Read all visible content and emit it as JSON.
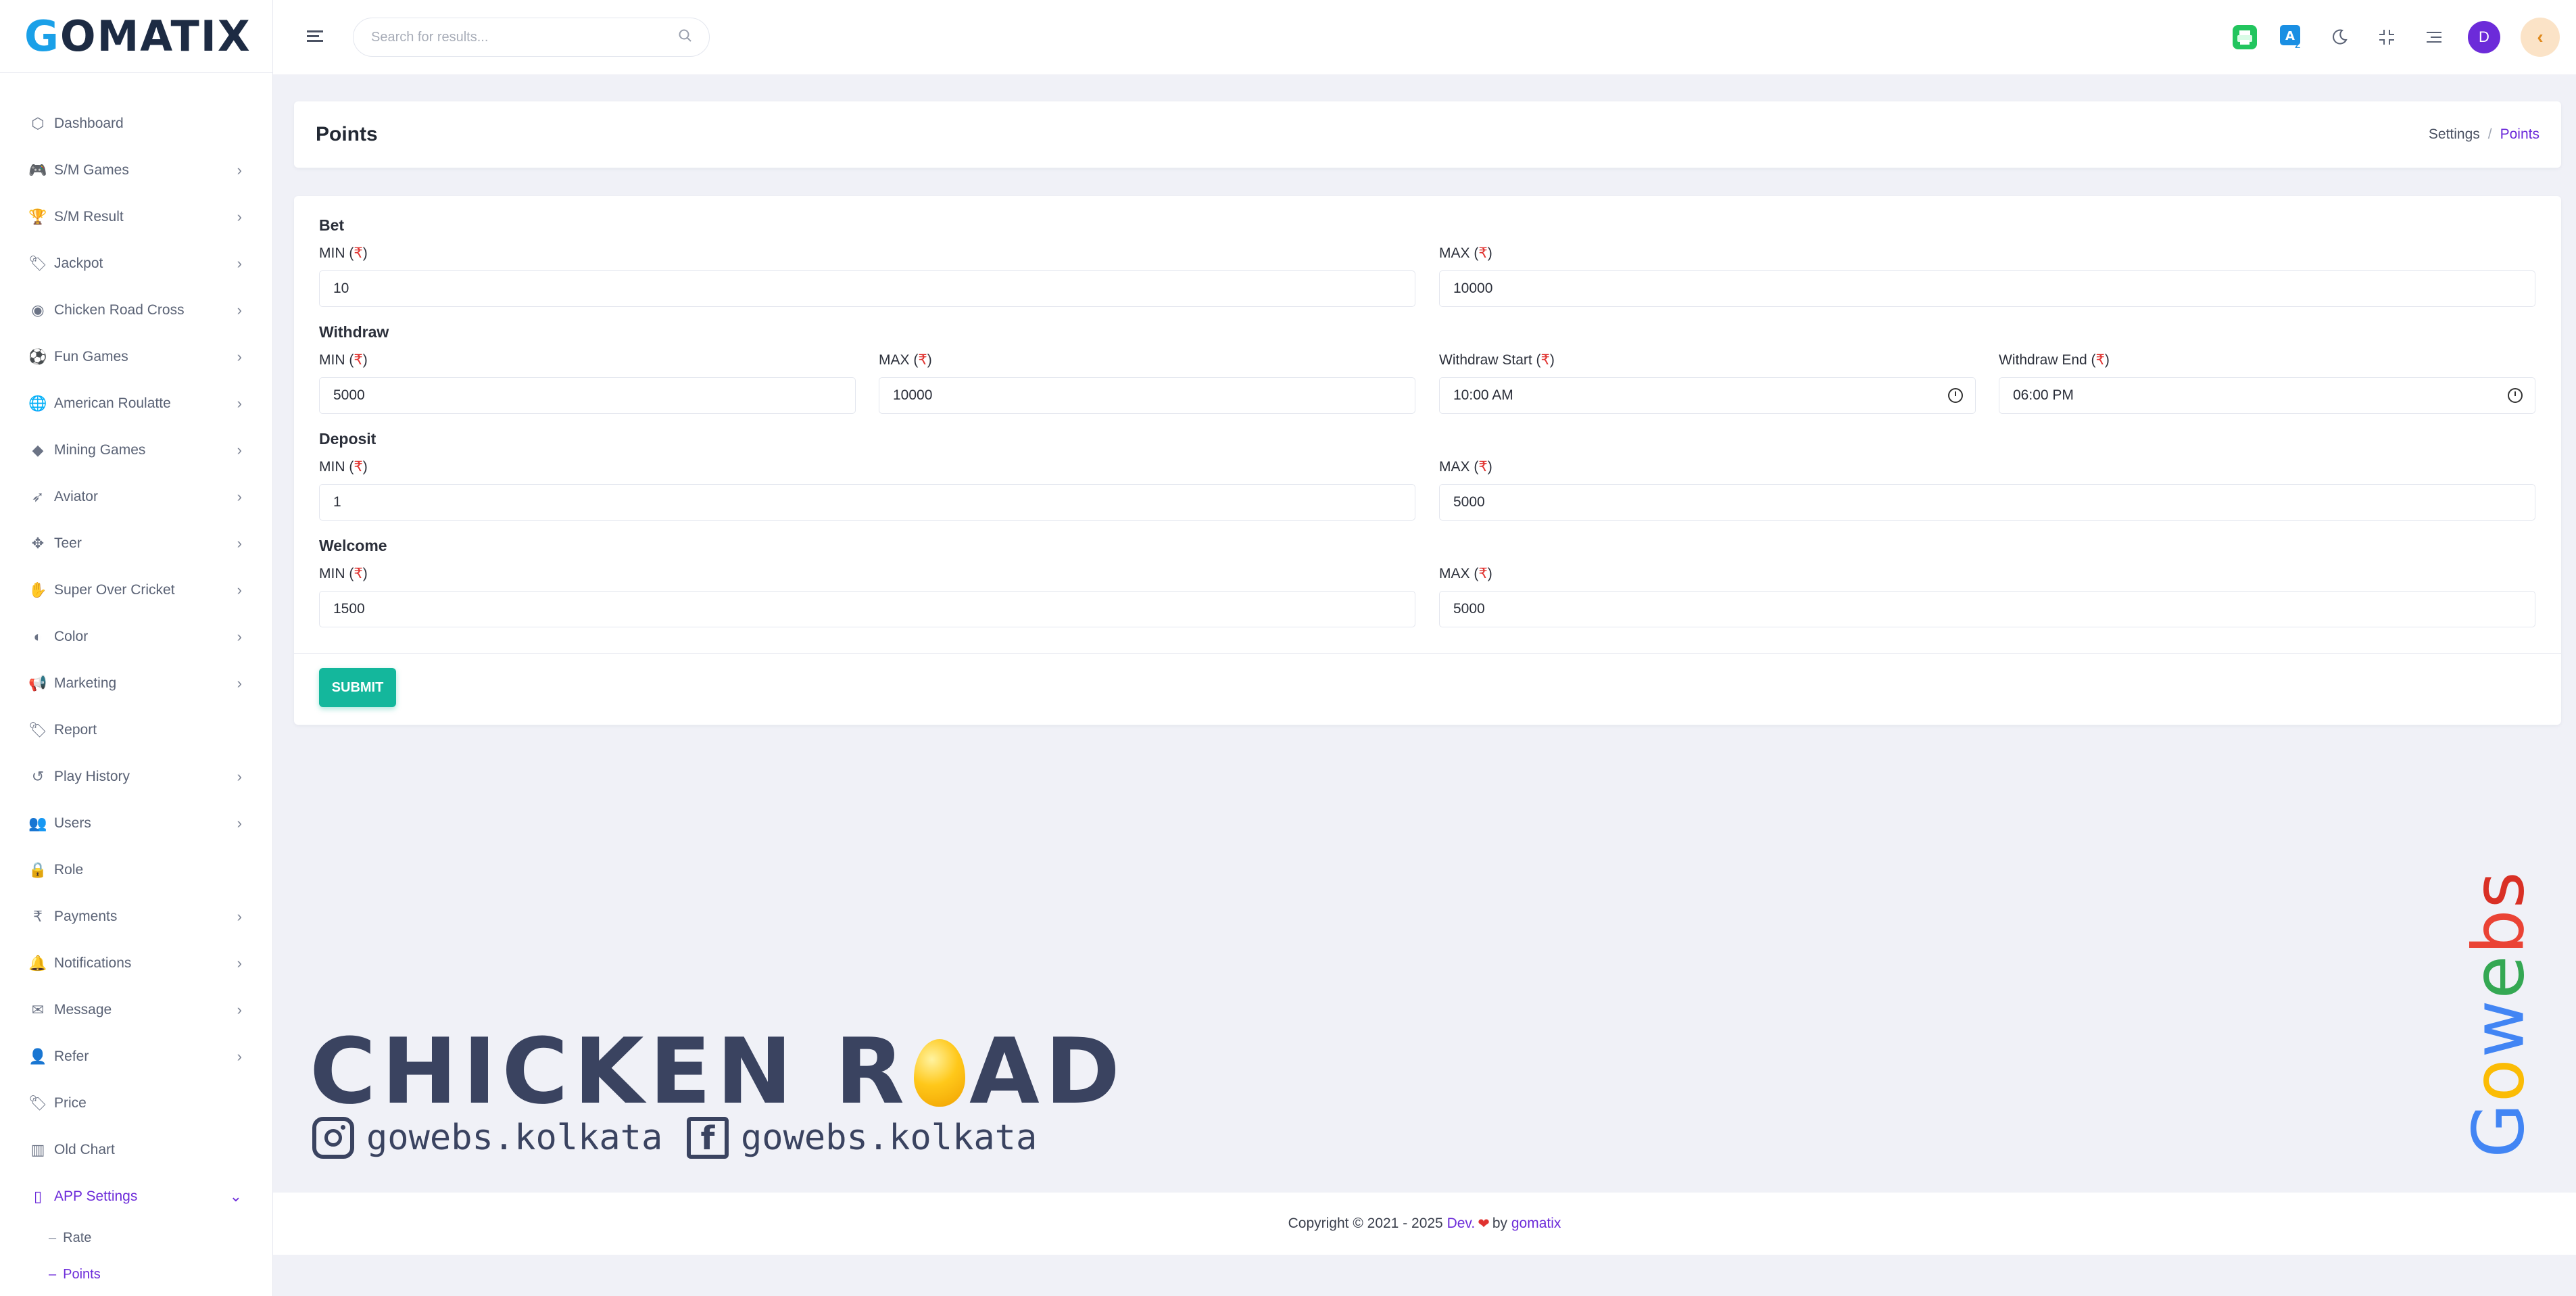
{
  "brand": {
    "logo_text": "GOMATIX",
    "accent": "#6c2bd9",
    "logo_color": "#1d2b43"
  },
  "sidebar": {
    "items": [
      {
        "label": "Dashboard",
        "icon": "cube-icon",
        "has_children": false
      },
      {
        "label": "S/M Games",
        "icon": "gamepad-icon",
        "has_children": true
      },
      {
        "label": "S/M Result",
        "icon": "trophy-icon",
        "has_children": true
      },
      {
        "label": "Jackpot",
        "icon": "tag-icon",
        "has_children": true
      },
      {
        "label": "Chicken Road Cross",
        "icon": "steering-icon",
        "has_children": true
      },
      {
        "label": "Fun Games",
        "icon": "soccer-icon",
        "has_children": true
      },
      {
        "label": "American Roulatte",
        "icon": "globe-icon",
        "has_children": true
      },
      {
        "label": "Mining Games",
        "icon": "diamond-icon",
        "has_children": true
      },
      {
        "label": "Aviator",
        "icon": "rocket-icon",
        "has_children": true
      },
      {
        "label": "Teer",
        "icon": "crosshair-icon",
        "has_children": true
      },
      {
        "label": "Super Over Cricket",
        "icon": "hand-icon",
        "has_children": true
      },
      {
        "label": "Color",
        "icon": "contrast-icon",
        "has_children": true
      },
      {
        "label": "Marketing",
        "icon": "megaphone-icon",
        "has_children": true
      },
      {
        "label": "Report",
        "icon": "tag-icon",
        "has_children": false
      },
      {
        "label": "Play History",
        "icon": "history-icon",
        "has_children": true
      },
      {
        "label": "Users",
        "icon": "users-icon",
        "has_children": true
      },
      {
        "label": "Role",
        "icon": "lock-icon",
        "has_children": false
      },
      {
        "label": "Payments",
        "icon": "rupee-icon",
        "has_children": true
      },
      {
        "label": "Notifications",
        "icon": "bell-icon",
        "has_children": true
      },
      {
        "label": "Message",
        "icon": "envelope-icon",
        "has_children": true
      },
      {
        "label": "Refer",
        "icon": "user-plus-icon",
        "has_children": true
      },
      {
        "label": "Price",
        "icon": "tag-icon",
        "has_children": false
      },
      {
        "label": "Old Chart",
        "icon": "bar-chart-icon",
        "has_children": false
      },
      {
        "label": "APP Settings",
        "icon": "mobile-icon",
        "has_children": true,
        "expanded": true
      }
    ],
    "sub_items": [
      {
        "label": "Rate"
      },
      {
        "label": "Points",
        "active": true
      }
    ]
  },
  "topbar": {
    "search_placeholder": "Search for results...",
    "avatar_initial": "D"
  },
  "page": {
    "title": "Points",
    "breadcrumb": [
      "Settings",
      "Points"
    ]
  },
  "form": {
    "currency_symbol": "₹",
    "sections": {
      "bet": {
        "title": "Bet",
        "min_label": "MIN (",
        "max_label": "MAX (",
        "min_value": "10",
        "max_value": "10000"
      },
      "withdraw": {
        "title": "Withdraw",
        "min_label": "MIN (",
        "max_label": "MAX (",
        "start_label": "Withdraw Start (",
        "end_label": "Withdraw End (",
        "min_value": "5000",
        "max_value": "10000",
        "start_value": "10:00 AM",
        "end_value": "06:00 PM"
      },
      "deposit": {
        "title": "Deposit",
        "min_label": "MIN (",
        "max_label": "MAX (",
        "min_value": "1",
        "max_value": "5000"
      },
      "welcome": {
        "title": "Welcome",
        "min_label": "MIN (",
        "max_label": "MAX (",
        "min_value": "1500",
        "max_value": "5000"
      }
    },
    "submit_label": "SUBMIT",
    "label_close": ")"
  },
  "banner": {
    "title_part1": "CHICKEN R",
    "title_part2": "AD",
    "instagram": "gowebs.kolkata",
    "facebook": "gowebs.kolkata",
    "side_logo": "Gowebs"
  },
  "footer": {
    "prefix": "Copyright © 2021 - 2025 ",
    "dev": "Dev.",
    "by": "by",
    "company": "gomatix"
  }
}
